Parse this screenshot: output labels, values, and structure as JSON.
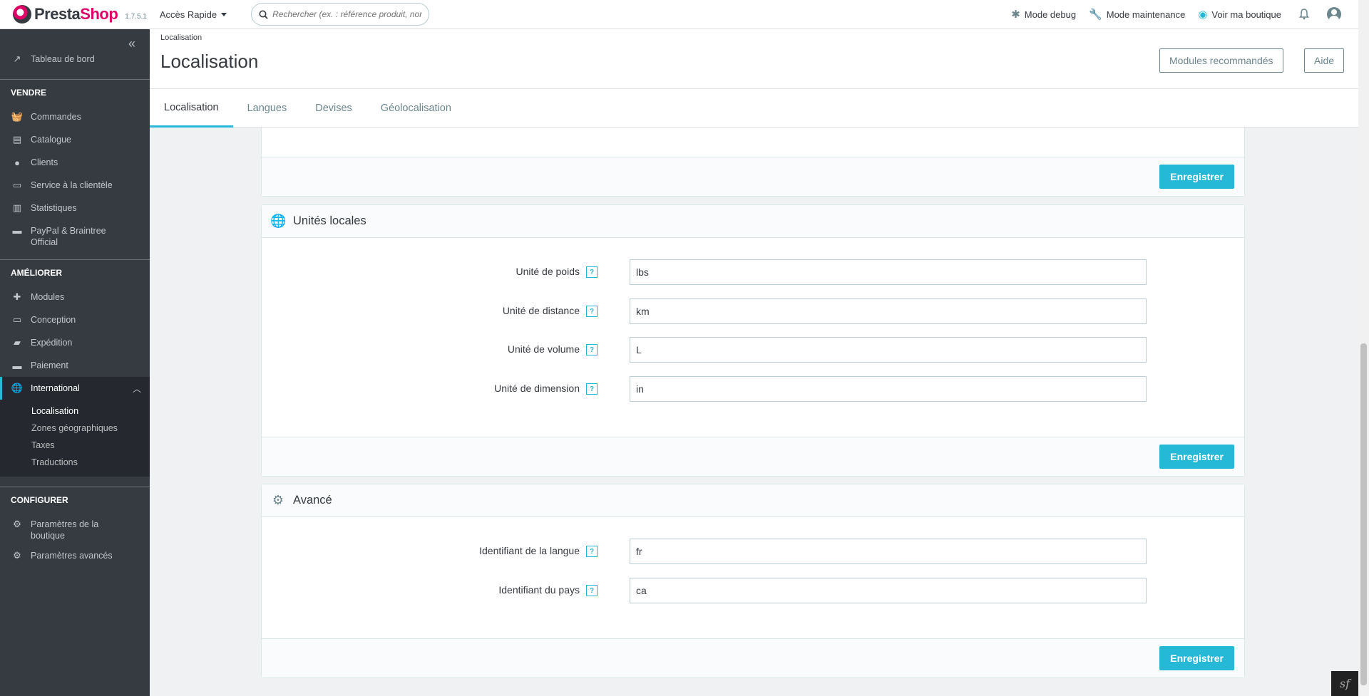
{
  "topbar": {
    "logo_part1": "Presta",
    "logo_part2": "Shop",
    "version": "1.7.5.1",
    "quick_access": "Accès Rapide",
    "search_placeholder": "Rechercher (ex. : référence produit, nom",
    "debug": "Mode debug",
    "maintenance": "Mode maintenance",
    "view_shop": "Voir ma boutique"
  },
  "sidebar": {
    "dashboard": "Tableau de bord",
    "sell_title": "VENDRE",
    "sell_items": [
      "Commandes",
      "Catalogue",
      "Clients",
      "Service à la clientèle",
      "Statistiques"
    ],
    "paypal_line1": "PayPal & Braintree",
    "paypal_line2": "Official",
    "improve_title": "AMÉLIORER",
    "improve_items": [
      "Modules",
      "Conception",
      "Expédition",
      "Paiement"
    ],
    "international": "International",
    "sub_items": [
      "Localisation",
      "Zones géographiques",
      "Taxes",
      "Traductions"
    ],
    "configure_title": "CONFIGURER",
    "shop_params_line1": "Paramètres de la",
    "shop_params_line2": "boutique",
    "advanced_params": "Paramètres avancés"
  },
  "header": {
    "breadcrumb": "Localisation",
    "title": "Localisation",
    "modules_btn": "Modules recommandés",
    "help_btn": "Aide",
    "tabs": [
      "Localisation",
      "Langues",
      "Devises",
      "Géolocalisation"
    ]
  },
  "panels": {
    "save_label": "Enregistrer",
    "units": {
      "title": "Unités locales",
      "fields": [
        {
          "label": "Unité de poids",
          "value": "lbs"
        },
        {
          "label": "Unité de distance",
          "value": "km"
        },
        {
          "label": "Unité de volume",
          "value": "L"
        },
        {
          "label": "Unité de dimension",
          "value": "in"
        }
      ]
    },
    "advanced": {
      "title": "Avancé",
      "fields": [
        {
          "label": "Identifiant de la langue",
          "value": "fr"
        },
        {
          "label": "Identifiant du pays",
          "value": "ca"
        }
      ]
    },
    "help_glyph": "?"
  }
}
